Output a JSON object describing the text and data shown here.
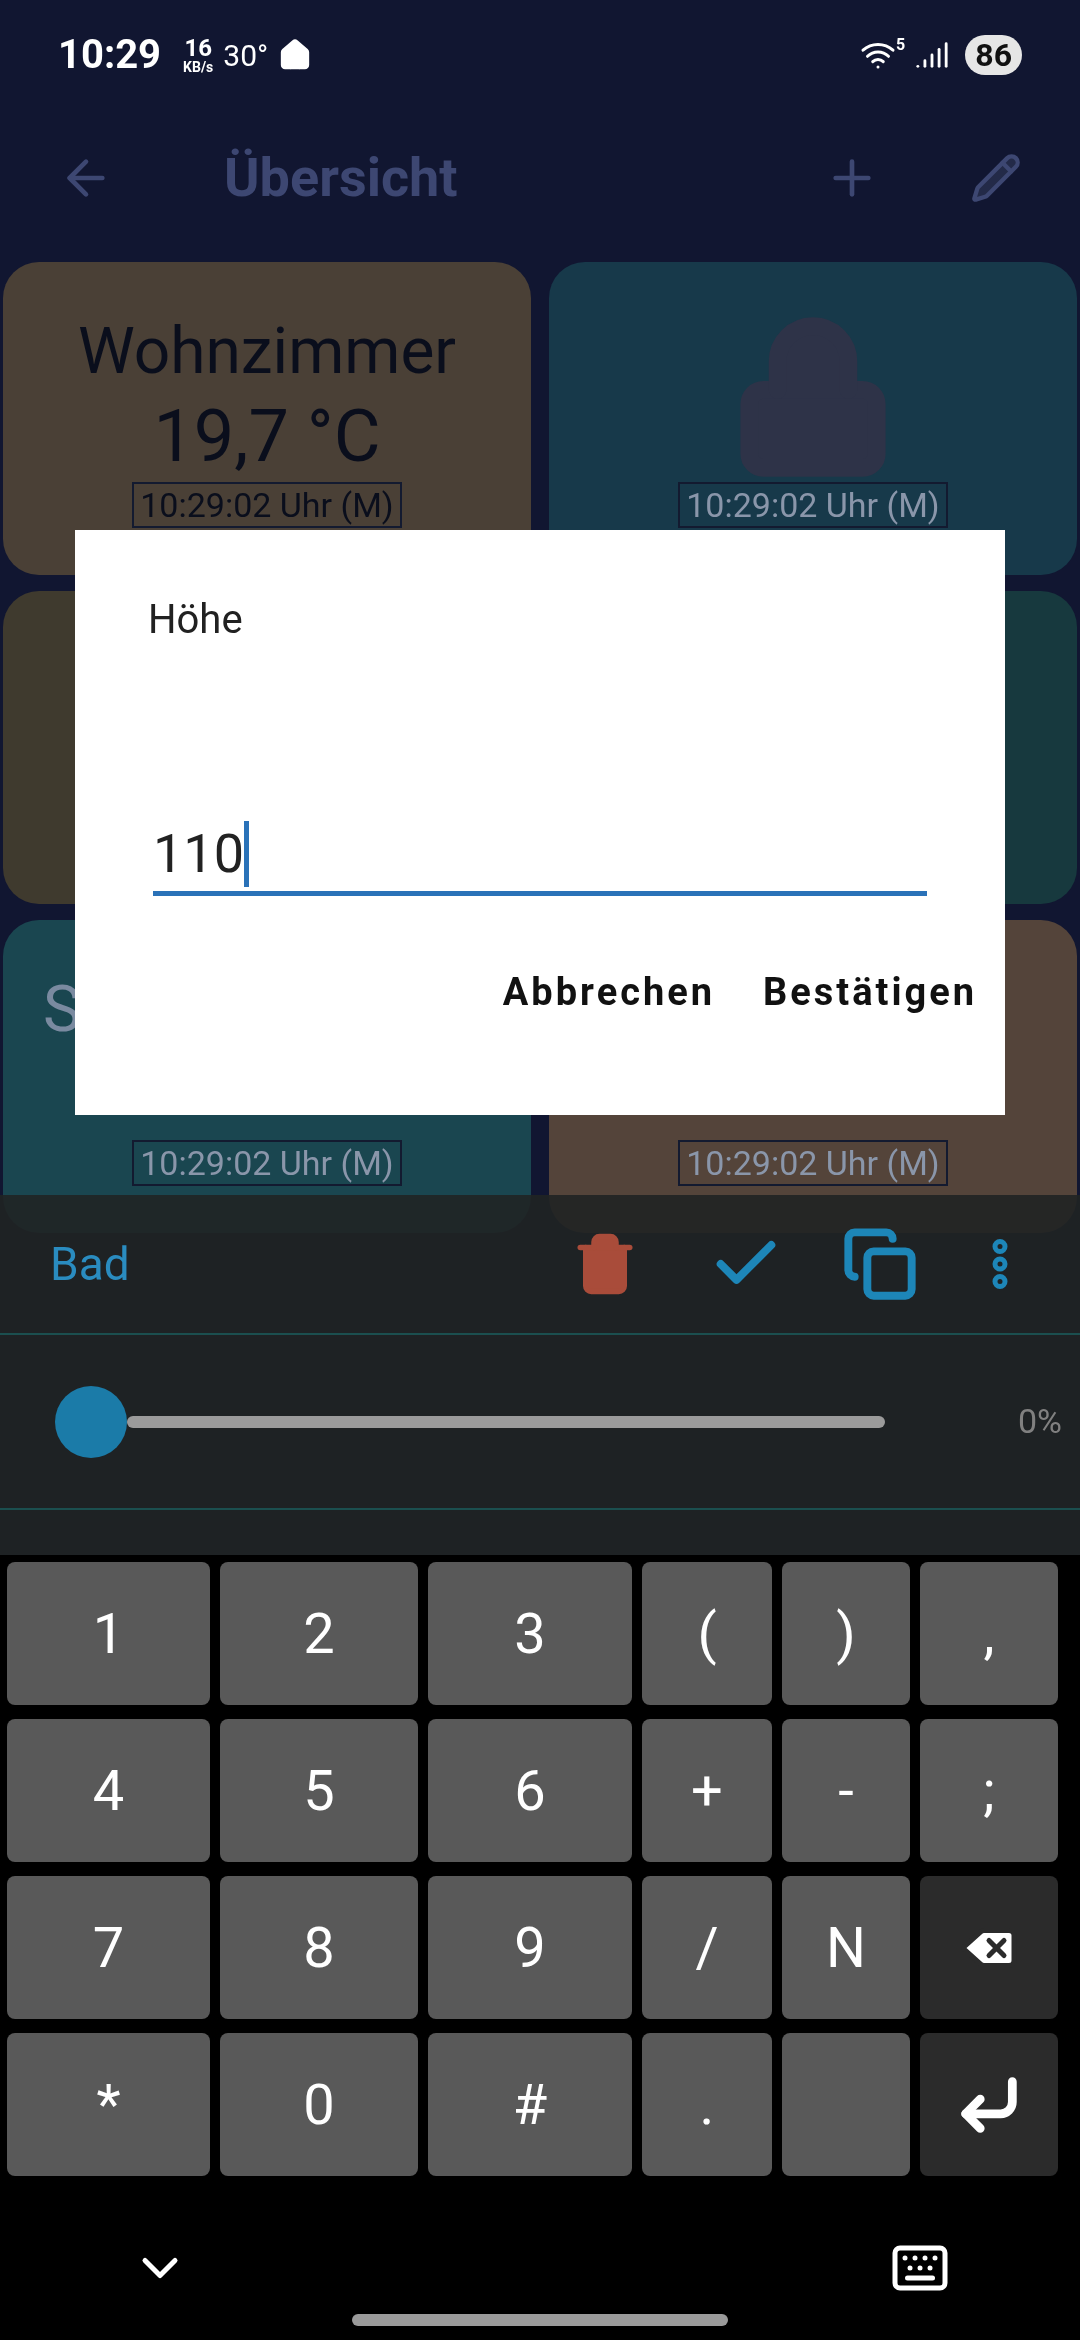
{
  "status_bar": {
    "time": "10:29",
    "net_speed": "16",
    "net_unit": "KB/s",
    "temperature": "30°",
    "wifi_badge": "5",
    "battery": "86"
  },
  "app_bar": {
    "title": "Übersicht"
  },
  "tiles": [
    {
      "name": "Wohnzimmer",
      "value": "19,7 °C",
      "timestamp": "10:29:02 Uhr (M)",
      "kind": "sensor",
      "color": "#4a4036"
    },
    {
      "timestamp": "10:29:02 Uhr (M)",
      "kind": "lock",
      "color": "#17394a"
    },
    {
      "kind": "blank",
      "color": "#3f3a2e"
    },
    {
      "kind": "blank",
      "color": "#17393e"
    },
    {
      "name": "S",
      "timestamp": "10:29:02 Uhr (M)",
      "kind": "sensor",
      "color": "#1a4650"
    },
    {
      "timestamp": "10:29:02 Uhr (M)",
      "kind": "blind",
      "color": "#54443a"
    }
  ],
  "dialog": {
    "title": "Höhe",
    "value": "110",
    "buttons": [
      "Abbrechen",
      "Bestätigen"
    ]
  },
  "panel": {
    "title": "Bad",
    "level": 0,
    "reading": "0%"
  },
  "keyboard": [
    {
      "kind": "char",
      "label": "1"
    },
    {
      "kind": "char",
      "label": "2"
    },
    {
      "kind": "char",
      "label": "3"
    },
    {
      "kind": "char",
      "label": "("
    },
    {
      "kind": "char",
      "label": ")"
    },
    {
      "kind": "char",
      "label": ","
    },
    {
      "kind": "char",
      "label": "4"
    },
    {
      "kind": "char",
      "label": "5"
    },
    {
      "kind": "char",
      "label": "6"
    },
    {
      "kind": "char",
      "label": "+"
    },
    {
      "kind": "char",
      "label": "-"
    },
    {
      "kind": "char",
      "label": ";"
    },
    {
      "kind": "char",
      "label": "7"
    },
    {
      "kind": "char",
      "label": "8"
    },
    {
      "kind": "char",
      "label": "9"
    },
    {
      "kind": "char",
      "label": "/"
    },
    {
      "kind": "char",
      "label": "N"
    },
    {
      "kind": "backspace"
    },
    {
      "kind": "char",
      "label": "*"
    },
    {
      "kind": "char",
      "label": "0"
    },
    {
      "kind": "char",
      "label": "#"
    },
    {
      "kind": "char",
      "label": "."
    },
    {
      "kind": "blank"
    },
    {
      "kind": "enter"
    }
  ]
}
